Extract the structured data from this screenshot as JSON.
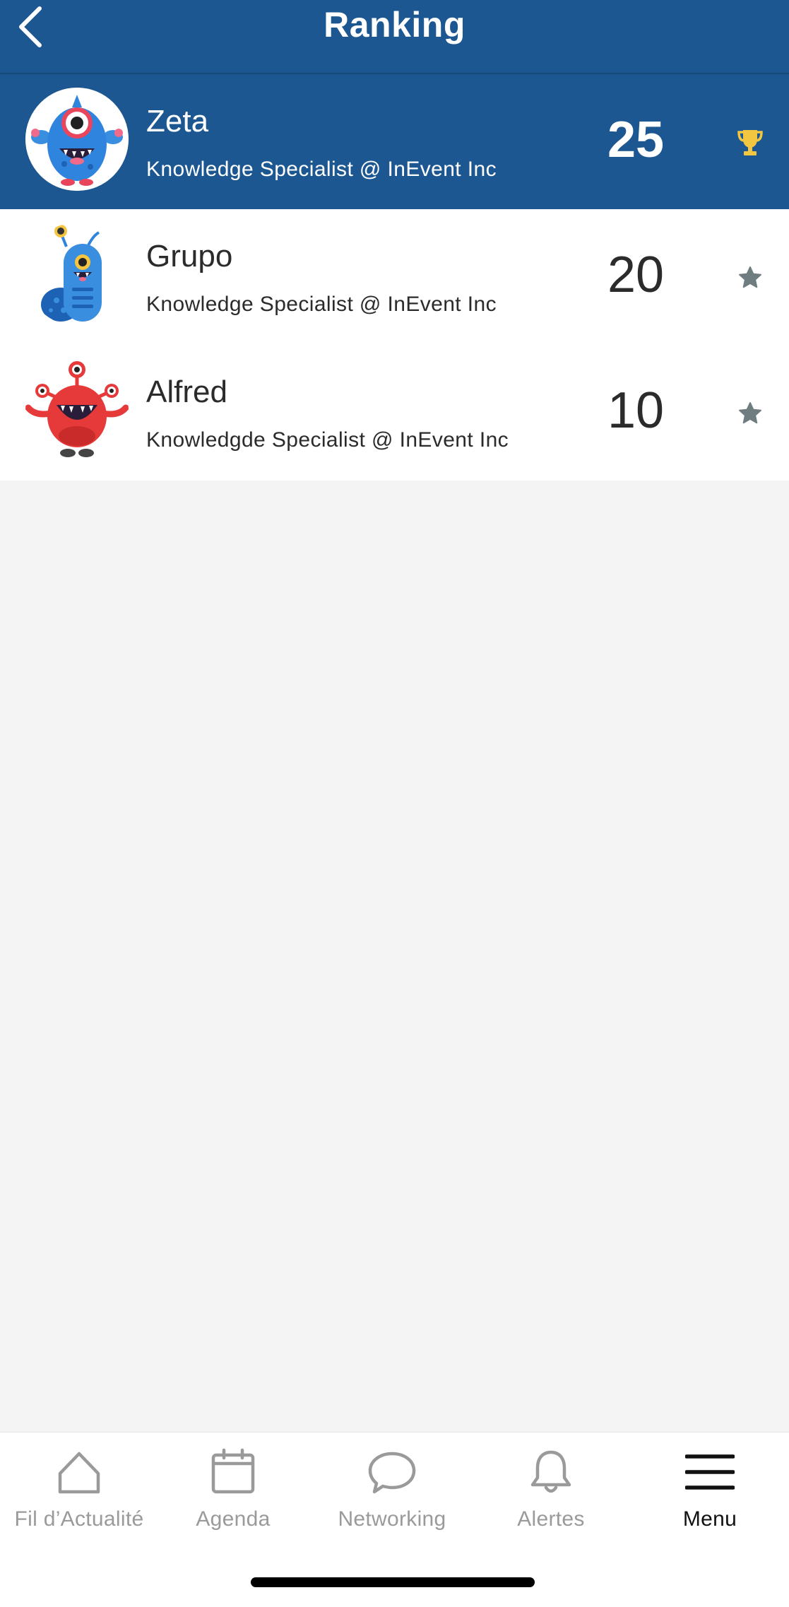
{
  "header": {
    "title": "Ranking",
    "back_icon": "chevron-left-icon"
  },
  "colors": {
    "brand": "#1c5791",
    "trophy": "#f2c640",
    "star": "#6f7d81",
    "background": "#f4f4f4"
  },
  "ranking": [
    {
      "name": "Zeta",
      "subtitle": "Knowledge Specialist @ InEvent Inc",
      "score": "25",
      "badge": "trophy-icon",
      "avatar": "blue-one-eyed-monster"
    },
    {
      "name": "Grupo",
      "subtitle": "Knowledge Specialist @ InEvent Inc",
      "score": "20",
      "badge": "star-icon",
      "avatar": "blue-worm-monster"
    },
    {
      "name": "Alfred",
      "subtitle": "Knowledgde Specialist @ InEvent Inc",
      "score": "10",
      "badge": "star-icon",
      "avatar": "red-three-eyed-monster"
    }
  ],
  "tabbar": {
    "tabs": [
      {
        "label": "Fil d’Actualité",
        "icon": "home-icon"
      },
      {
        "label": "Agenda",
        "icon": "calendar-icon"
      },
      {
        "label": "Networking",
        "icon": "chat-bubble-icon"
      },
      {
        "label": "Alertes",
        "icon": "bell-icon"
      },
      {
        "label": "Menu",
        "icon": "hamburger-menu-icon"
      }
    ],
    "active": "Menu"
  }
}
